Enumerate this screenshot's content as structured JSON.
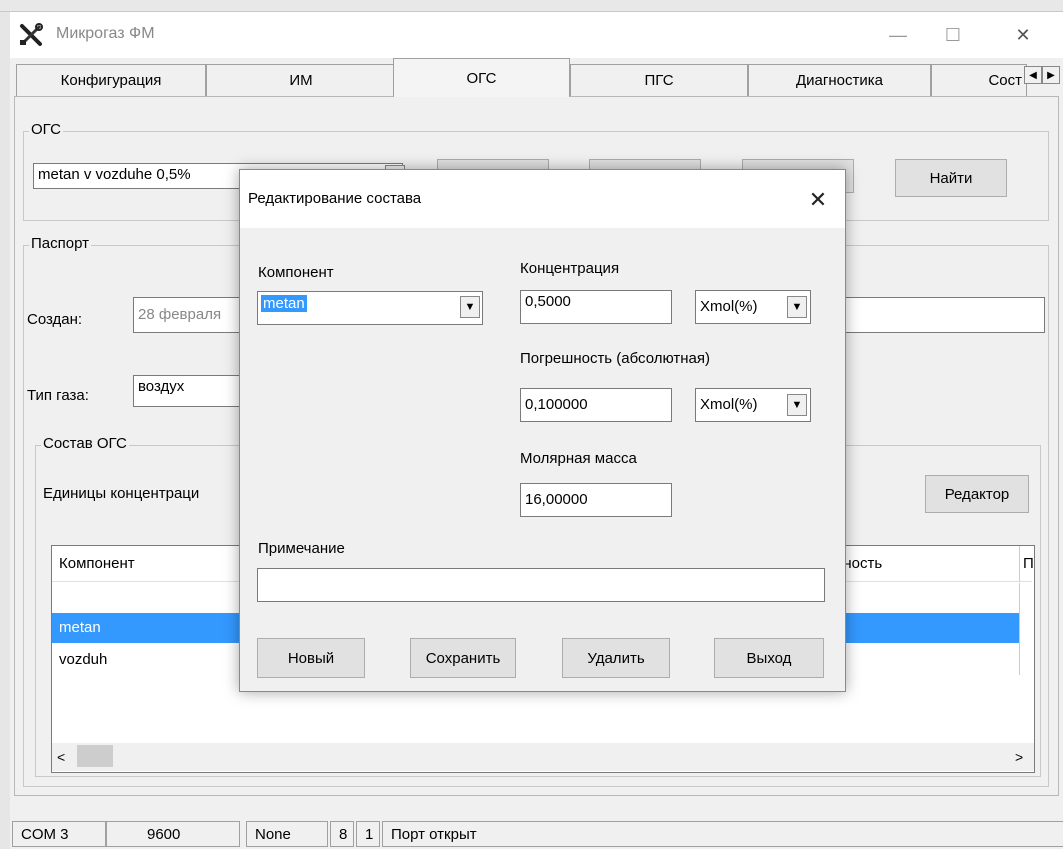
{
  "window": {
    "title": "Микрогаз ФМ",
    "minimize": "—",
    "maximize": "☐",
    "close": "✕"
  },
  "tabs": [
    {
      "label": "Конфигурация"
    },
    {
      "label": "ИМ"
    },
    {
      "label": "ОГС"
    },
    {
      "label": "ПГС"
    },
    {
      "label": "Диагностика"
    },
    {
      "label": "Сост"
    }
  ],
  "ogs": {
    "group_label": "ОГС",
    "combo_value": "metan v vozduhe 0,5%",
    "find_button": "Найти"
  },
  "passport": {
    "group_label": "Паспорт",
    "created_label": "Создан:",
    "created_value": "28 февраля",
    "gas_type_label": "Тип газа:",
    "gas_type_value": "воздух"
  },
  "composition": {
    "group_label": "Состав ОГС",
    "units_label": "Единицы концентраци",
    "editor_button": "Редактор",
    "columns": [
      "Компонент",
      "ешность",
      "П"
    ],
    "rows": [
      {
        "component": "metan",
        "selected": true
      },
      {
        "component": "vozduh",
        "selected": false
      }
    ]
  },
  "statusbar": {
    "port": "COM 3",
    "baud": "9600",
    "parity": "None",
    "data_bits": "8",
    "stop_bits": "1",
    "status": "Порт открыт"
  },
  "dialog": {
    "title": "Редактирование состава",
    "close": "✕",
    "component_label": "Компонент",
    "component_value": "metan",
    "concentration_label": "Концентрация",
    "concentration_value": "0,5000",
    "concentration_unit": "Xmol(%)",
    "error_label": "Погрешность (абсолютная)",
    "error_value": "0,100000",
    "error_unit": "Xmol(%)",
    "molar_mass_label": "Молярная масса",
    "molar_mass_value": "16,00000",
    "note_label": "Примечание",
    "note_value": "",
    "buttons": {
      "new": "Новый",
      "save": "Сохранить",
      "delete": "Удалить",
      "exit": "Выход"
    }
  }
}
